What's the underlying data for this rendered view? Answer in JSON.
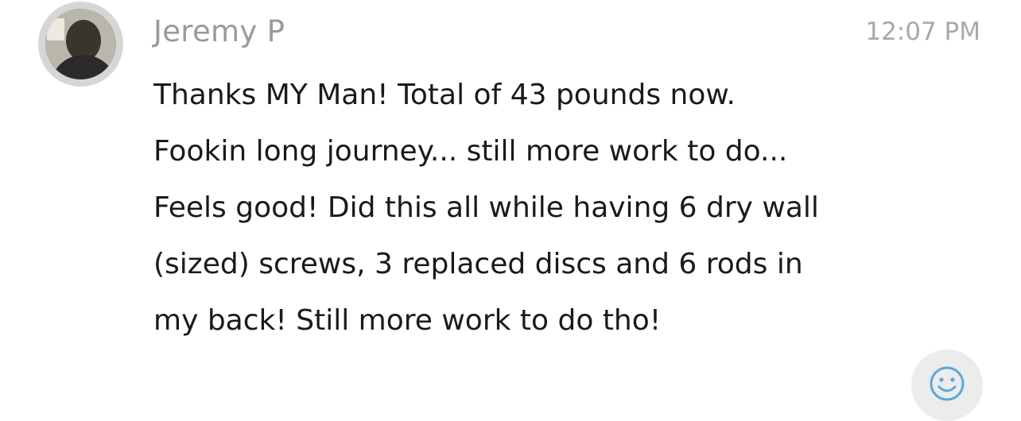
{
  "message": {
    "sender": "Jeremy P",
    "timestamp": "12:07 PM",
    "lines": [
      "Thanks MY Man! Total of 43 pounds now.",
      "Fookin long journey... still more work to do...",
      "Feels good! Did this all while having 6 dry wall",
      "(sized) screws, 3 replaced discs and 6 rods in",
      "my back!  Still more work to do tho!"
    ]
  },
  "reaction": {
    "icon": "smiley-icon",
    "color": "#5aa9d8"
  }
}
